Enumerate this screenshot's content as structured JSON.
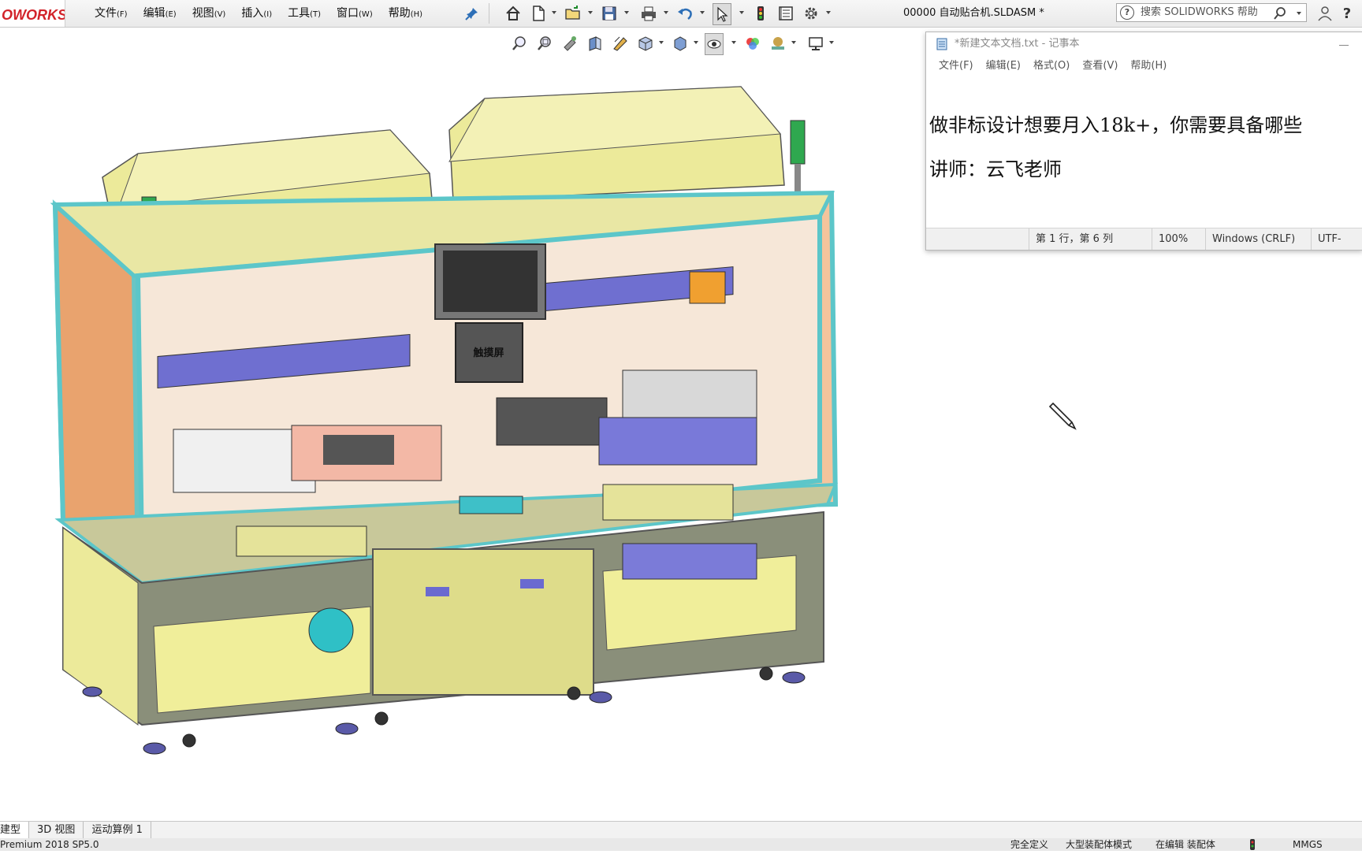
{
  "app": {
    "logo_text": "OWORKS",
    "document_title": "00000 自动贴合机.SLDASM *"
  },
  "menu": [
    {
      "label": "文件",
      "key": "(F)"
    },
    {
      "label": "编辑",
      "key": "(E)"
    },
    {
      "label": "视图",
      "key": "(V)"
    },
    {
      "label": "插入",
      "key": "(I)"
    },
    {
      "label": "工具",
      "key": "(T)"
    },
    {
      "label": "窗口",
      "key": "(W)"
    },
    {
      "label": "帮助",
      "key": "(H)"
    }
  ],
  "search": {
    "placeholder": "搜索 SOLIDWORKS 帮助"
  },
  "toolbar_icons": [
    "home-icon",
    "new-document-icon",
    "open-folder-icon",
    "save-icon",
    "print-icon",
    "undo-icon",
    "select-cursor-icon",
    "traffic-light-icon",
    "file-properties-icon",
    "options-gear-icon",
    "user-icon",
    "help-icon"
  ],
  "view_toolbar_icons": [
    "zoom-to-fit-icon",
    "zoom-area-icon",
    "previous-view-icon",
    "section-view-icon",
    "dynamic-annotation-icon",
    "view-orientation-icon",
    "display-style-icon",
    "hide-show-items-icon",
    "edit-appearance-icon",
    "apply-scene-icon",
    "view-settings-icon"
  ],
  "notepad": {
    "title": "*新建文本文档.txt - 记事本",
    "menu": [
      "文件(F)",
      "编辑(E)",
      "格式(O)",
      "查看(V)",
      "帮助(H)"
    ],
    "lines": [
      "做非标设计想要月入18k+，你需要具备哪些",
      "讲师：云飞老师"
    ],
    "status": {
      "position": "第 1 行，第 6 列",
      "zoom": "100%",
      "line_ending": "Windows (CRLF)",
      "encoding": "UTF-"
    }
  },
  "model": {
    "screen_label": "触摸屏"
  },
  "bottom_tabs": [
    "建型",
    "3D 视图",
    "运动算例 1"
  ],
  "statusbar": {
    "version": "Premium 2018 SP5.0",
    "state": "完全定义",
    "mode": "大型装配体模式",
    "editing": "在编辑 装配体",
    "units": "MMGS"
  },
  "colors": {
    "frame": "#5cc6c9",
    "covers": "#ecea9a",
    "orange_panel": "#e8a06a",
    "base": "#8a8f7a",
    "accent_red": "#d2232a"
  }
}
